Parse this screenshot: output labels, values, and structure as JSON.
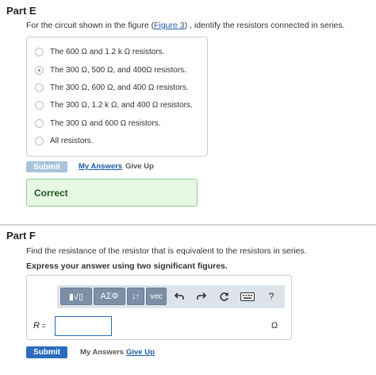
{
  "part_e": {
    "title": "Part E",
    "question_before": "For the circuit shown in the figure (",
    "figure_link": "Figure 3",
    "question_after": ") , identify the resistors connected in series.",
    "choices": [
      {
        "label": "The 600 Ω and 1.2 k Ω resistors.",
        "selected": false
      },
      {
        "label": "The 300 Ω, 500 Ω, and 400Ω resistors.",
        "selected": true
      },
      {
        "label": "The 300 Ω, 600 Ω, and 400 Ω resistors.",
        "selected": false
      },
      {
        "label": "The 300 Ω, 1.2 k Ω, and 400 Ω resistors.",
        "selected": false
      },
      {
        "label": "The 300 Ω and 600 Ω resistors.",
        "selected": false
      },
      {
        "label": "All resistors.",
        "selected": false
      }
    ],
    "submit_label": "Submit",
    "my_answers_label": "My Answers",
    "give_up_label": "Give Up",
    "feedback": "Correct"
  },
  "part_f": {
    "title": "Part F",
    "question": "Find the resistance of the resistor that is equivalent to the resistors in series.",
    "instruction": "Express your answer using two significant figures.",
    "toolbar": {
      "templates_label": "▮√▯",
      "greek_label": "ΑΣΦ",
      "arrows_label": "↓↑",
      "vec_label": "vec",
      "help_label": "?"
    },
    "variable": "R",
    "equals": " =",
    "answer_value": "",
    "unit": "Ω",
    "submit_label": "Submit",
    "my_answers_label": "My Answers",
    "give_up_label": "Give Up"
  }
}
